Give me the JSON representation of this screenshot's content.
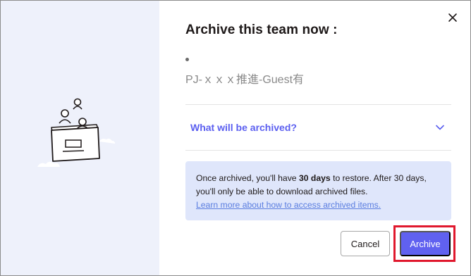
{
  "dialog": {
    "title": "Archive this team now :",
    "team_name": "PJ-ｘｘｘ推進-Guest有",
    "close_icon": "close-icon",
    "illustration_icon": "team-box-illustration"
  },
  "accordion": {
    "label": "What will be archived?",
    "icon": "chevron-down-icon"
  },
  "info": {
    "text_before": "Once archived, you'll have ",
    "days": "30 days",
    "text_after": " to restore. After 30 days, you'll only be able to download archived files.",
    "link": "Learn more about how to access archived items."
  },
  "buttons": {
    "cancel": "Cancel",
    "archive": "Archive"
  },
  "colors": {
    "accent": "#6061f0",
    "left_panel": "#eef1fb",
    "info_bg": "#dfe6fb",
    "highlight": "#e0182d"
  }
}
